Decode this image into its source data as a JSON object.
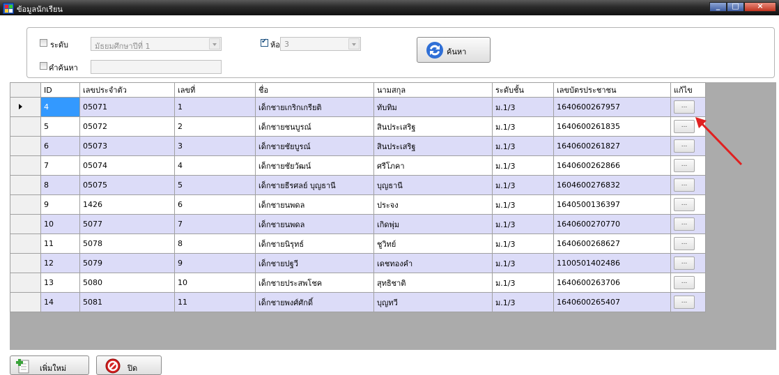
{
  "window": {
    "title": "ข้อมูลนักเรียน"
  },
  "filter": {
    "level_label": "ระดับ",
    "level_checked": false,
    "level_value": "มัธยมศึกษาปีที่ 1",
    "room_label": "ห้อง",
    "room_checked": true,
    "room_value": "3",
    "keyword_label": "คำค้นหา",
    "keyword_checked": false,
    "keyword_value": "",
    "search_button": "ค้นหา"
  },
  "table": {
    "columns": [
      "ID",
      "เลขประจำตัว",
      "เลขที่",
      "ชื่อ",
      "นามสกุล",
      "ระดับชั้น",
      "เลขบัตรประชาชน",
      "แก้ไข"
    ],
    "edit_label": "...",
    "rows": [
      {
        "id": "4",
        "code": "05071",
        "no": "1",
        "name": "เด็กชายเกริกเกรียติ",
        "surname": "ทับทิม",
        "level": "ม.1/3",
        "citizen": "1640600267957"
      },
      {
        "id": "5",
        "code": "05072",
        "no": "2",
        "name": "เด็กชายชนบูรณ์",
        "surname": "สินประเสริฐ",
        "level": "ม.1/3",
        "citizen": "1640600261835"
      },
      {
        "id": "6",
        "code": "05073",
        "no": "3",
        "name": "เด็กชายชัยบูรณ์",
        "surname": "สินประเสริฐ",
        "level": "ม.1/3",
        "citizen": "1640600261827"
      },
      {
        "id": "7",
        "code": "05074",
        "no": "4",
        "name": "เด็กชายชัยวัฒน์",
        "surname": "ศรีโภคา",
        "level": "ม.1/3",
        "citizen": "1640600262866"
      },
      {
        "id": "8",
        "code": "05075",
        "no": "5",
        "name": "เด็กชายธีรศลย์ บุญธานี",
        "surname": "บุญธานี",
        "level": "ม.1/3",
        "citizen": "1604600276832"
      },
      {
        "id": "9",
        "code": "1426",
        "no": "6",
        "name": "เด็กชายนพดล",
        "surname": "ประจง",
        "level": "ม.1/3",
        "citizen": "1640500136397"
      },
      {
        "id": "10",
        "code": "5077",
        "no": "7",
        "name": "เด็กชายนพดล",
        "surname": "เกิดพุ่ม",
        "level": "ม.1/3",
        "citizen": "1640600270770"
      },
      {
        "id": "11",
        "code": "5078",
        "no": "8",
        "name": "เด็กชายนิรุทธ์",
        "surname": "ชูวิทย์",
        "level": "ม.1/3",
        "citizen": "1640600268627"
      },
      {
        "id": "12",
        "code": "5079",
        "no": "9",
        "name": "เด็กชายปฐวี",
        "surname": "เดชทองคำ",
        "level": "ม.1/3",
        "citizen": "1100501402486"
      },
      {
        "id": "13",
        "code": "5080",
        "no": "10",
        "name": "เด็กชายประสพโชค",
        "surname": "สุทธิชาติ",
        "level": "ม.1/3",
        "citizen": "1640600263706"
      },
      {
        "id": "14",
        "code": "5081",
        "no": "11",
        "name": "เด็กชายพงศ์ศักดิ์",
        "surname": "บุญทวี",
        "level": "ม.1/3",
        "citizen": "1640600265407"
      }
    ]
  },
  "footer": {
    "add_button": "เพิ่มใหม่",
    "close_button": "ปิด"
  },
  "colors": {
    "row_alt": "#dcdcf8",
    "selection": "#3399ff",
    "annotation_arrow": "#e02020"
  },
  "icons": {
    "app": "app-icon",
    "search": "refresh-icon",
    "add": "add-document-icon",
    "close": "cancel-icon"
  }
}
